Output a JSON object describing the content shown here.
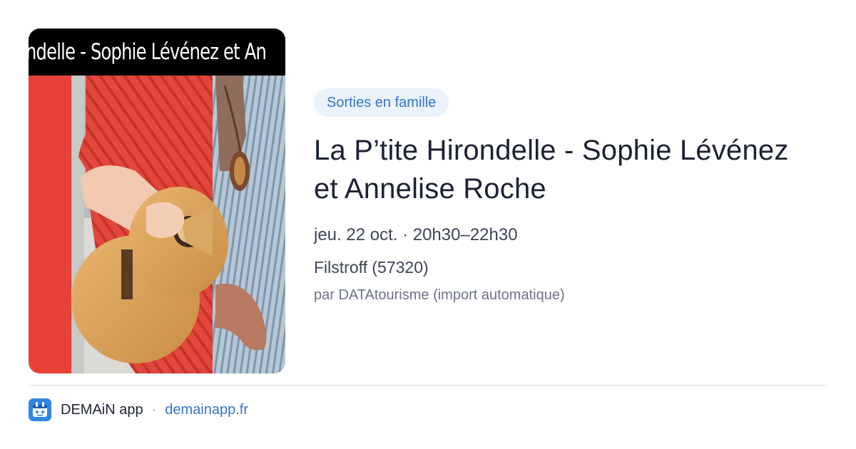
{
  "image": {
    "banner_text": "ndelle - Sophie Lévénez et An",
    "description_icon": "guitar-photo"
  },
  "event": {
    "category": "Sorties en famille",
    "title": "La P’tite Hirondelle - Sophie Lévénez et Annelise Roche",
    "datetime": "jeu. 22 oct. · 20h30–22h30",
    "location": "Filstroff (57320)",
    "source": "par DATAtourisme (import automatique)"
  },
  "footer": {
    "app_icon": "demain-logo-icon",
    "app_name": "DEMAiN app",
    "separator": "·",
    "link": "demainapp.fr"
  },
  "colors": {
    "accent": "#3576c4",
    "badge_background": "#eaf2fb",
    "logo_blue": "#2f86e5"
  }
}
